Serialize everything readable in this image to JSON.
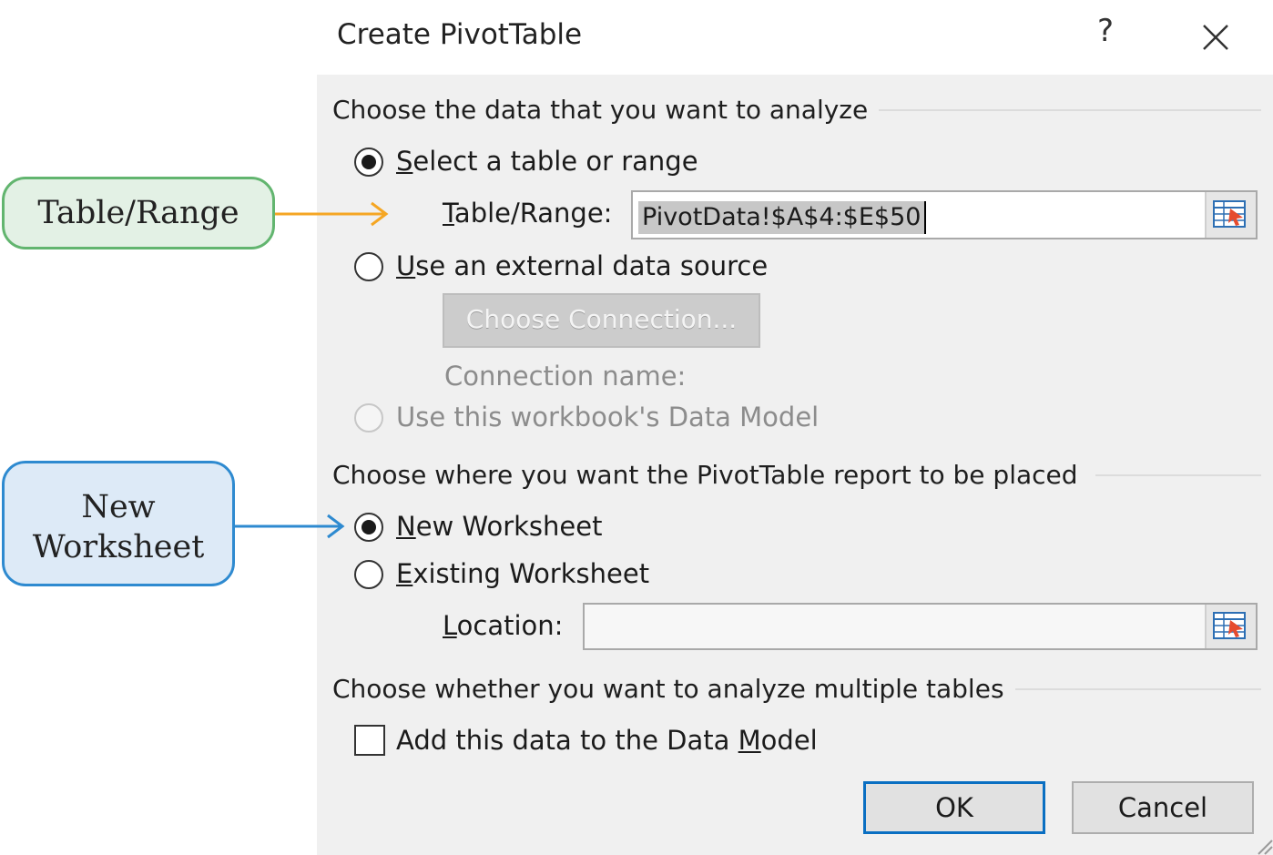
{
  "dialog": {
    "title": "Create PivotTable",
    "help_label": "?",
    "close_icon": "close-icon"
  },
  "section_data": {
    "title": "Choose the data that you want to analyze",
    "select_table_prefix": "S",
    "select_table_rest": "elect a table or range",
    "select_table_checked": true,
    "table_range_prefix": "T",
    "table_range_rest": "able/Range:",
    "table_range_value": "PivotData!$A$4:$E$50",
    "external_prefix": "U",
    "external_rest": "se an external data source",
    "choose_connection_label": "Choose Connection...",
    "connection_name_label": "Connection name:",
    "data_model_label": "Use this workbook's Data Model"
  },
  "section_place": {
    "title": "Choose where you want the PivotTable report to be placed",
    "new_ws_prefix": "N",
    "new_ws_rest": "ew Worksheet",
    "new_ws_checked": true,
    "existing_ws_prefix": "E",
    "existing_ws_rest": "xisting Worksheet",
    "location_prefix": "L",
    "location_rest": "ocation:",
    "location_value": ""
  },
  "section_multi": {
    "title": "Choose whether you want to analyze multiple tables",
    "add_data_model_before": "Add this data to the Data ",
    "add_data_model_underlined": "M",
    "add_data_model_after": "odel",
    "add_data_model_checked": false
  },
  "buttons": {
    "ok_label": "OK",
    "cancel_label": "Cancel"
  },
  "callouts": {
    "table_range": "Table/Range",
    "new_worksheet_line1": "New",
    "new_worksheet_line2": "Worksheet"
  },
  "colors": {
    "callout_green_border": "#62b56f",
    "callout_blue_border": "#2e8ad0",
    "arrow_orange": "#f5a623",
    "arrow_blue": "#2e8ad0",
    "default_button_border": "#0a6fc2"
  }
}
